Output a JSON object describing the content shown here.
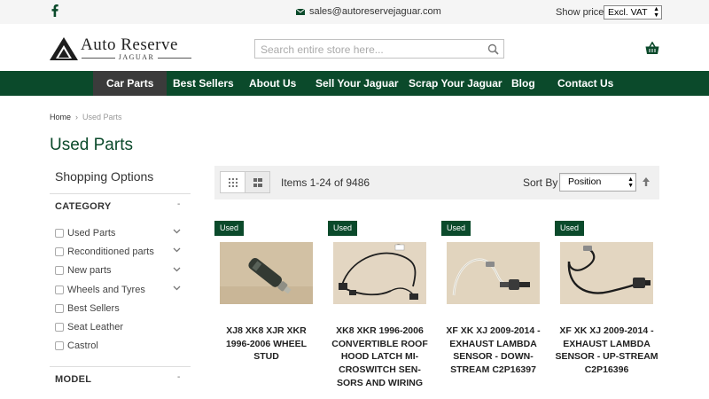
{
  "topbar": {
    "email": "sales@autoreservejaguar.com",
    "show_prices_label": "Show prices",
    "vat_selected": "Excl. VAT"
  },
  "logo": {
    "main": "Auto Reserve",
    "sub": "JAGUAR"
  },
  "search": {
    "placeholder": "Search entire store here..."
  },
  "nav": {
    "items": [
      "Car Parts",
      "Best Sellers",
      "About Us",
      "Sell Your Jaguar",
      "Scrap Your Jaguar",
      "Blog",
      "Contact Us"
    ],
    "active": "Car Parts"
  },
  "breadcrumb": {
    "home": "Home",
    "current": "Used Parts"
  },
  "page_title": "Used Parts",
  "sidebar": {
    "shopping_options": "Shopping Options",
    "category_title": "CATEGORY",
    "categories": [
      {
        "label": "Used Parts",
        "expandable": true
      },
      {
        "label": "Reconditioned parts",
        "expandable": true
      },
      {
        "label": "New parts",
        "expandable": true
      },
      {
        "label": "Wheels and Tyres",
        "expandable": true
      },
      {
        "label": "Best Sellers",
        "expandable": false
      },
      {
        "label": "Seat Leather",
        "expandable": false
      },
      {
        "label": "Castrol",
        "expandable": false
      }
    ],
    "model_title": "MODEL"
  },
  "toolbar": {
    "items_count": "Items 1-24 of 9486",
    "sort_label": "Sort By",
    "sort_selected": "Position"
  },
  "products": [
    {
      "badge": "Used",
      "name": "XJ8 XK8 XJR XKR 1996-2006 WHEEL STUD"
    },
    {
      "badge": "Used",
      "name": "XK8 XKR 1996-2006 CONVERTIBLE ROOF HOOD LATCH MI-CROSWITCH SEN-SORS AND WIRING"
    },
    {
      "badge": "Used",
      "name": "XF XK XJ 2009-2014 - EXHAUST LAMBDA SENSOR - DOWN-STREAM C2P16397"
    },
    {
      "badge": "Used",
      "name": "XF XK XJ 2009-2014 - EXHAUST LAMBDA SENSOR - UP-STREAM C2P16396"
    }
  ],
  "colors": {
    "brand_green": "#0b4a2b",
    "nav_active": "#3b3b3b"
  },
  "icons": {
    "facebook": "facebook-icon",
    "mail": "mail-icon",
    "search": "search-icon",
    "cart": "basket-icon",
    "chevron": "chevron-down-icon",
    "grid": "grid-view-icon",
    "list": "list-view-icon",
    "sort_direction": "arrow-up-icon"
  }
}
